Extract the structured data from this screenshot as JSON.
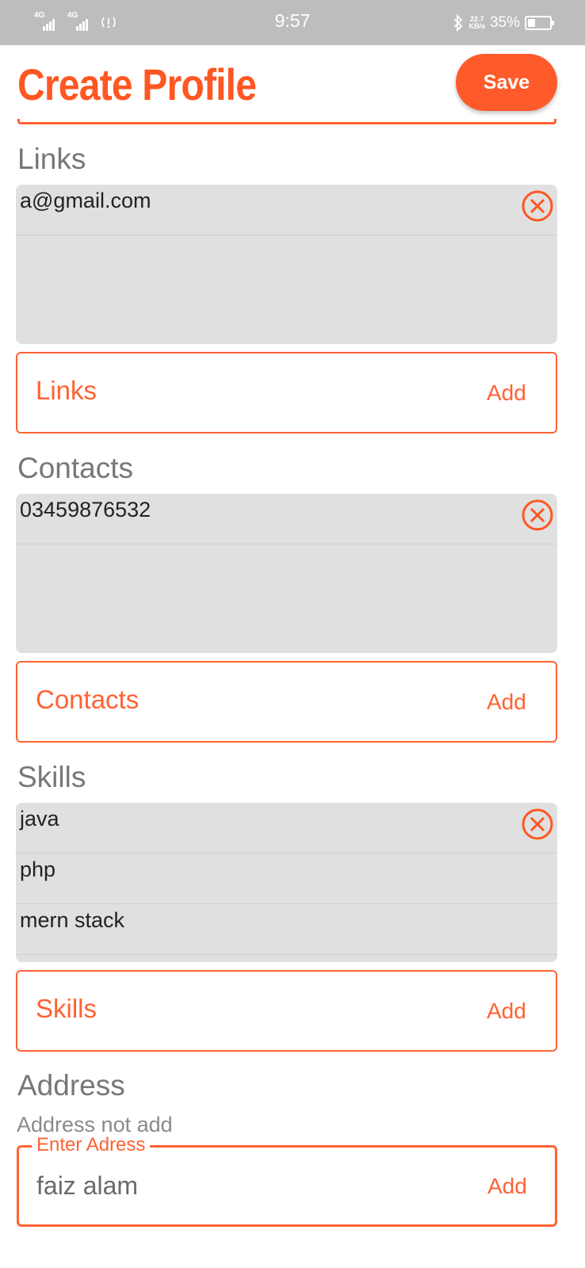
{
  "status_bar": {
    "net1": "4G",
    "net2": "4G",
    "time": "9:57",
    "speed_value": "22.7",
    "speed_unit": "KB/s",
    "battery": "35%",
    "battery_level": 0.35
  },
  "header": {
    "title": "Create Profile",
    "save_label": "Save"
  },
  "links": {
    "heading": "Links",
    "items": [
      "a@gmail.com"
    ],
    "input_placeholder": "Links",
    "add_label": "Add"
  },
  "contacts": {
    "heading": "Contacts",
    "items": [
      "03459876532"
    ],
    "input_placeholder": "Contacts",
    "add_label": "Add"
  },
  "skills": {
    "heading": "Skills",
    "items": [
      "java",
      "php",
      "mern stack"
    ],
    "input_placeholder": "Skills",
    "add_label": "Add"
  },
  "address": {
    "heading": "Address",
    "note": "Address not add",
    "field_label": "Enter Adress",
    "value": "faiz alam",
    "add_label": "Add"
  },
  "colors": {
    "accent": "#ff5722",
    "list_bg": "#e0e0e0",
    "status_bar": "#bdbdbd"
  }
}
